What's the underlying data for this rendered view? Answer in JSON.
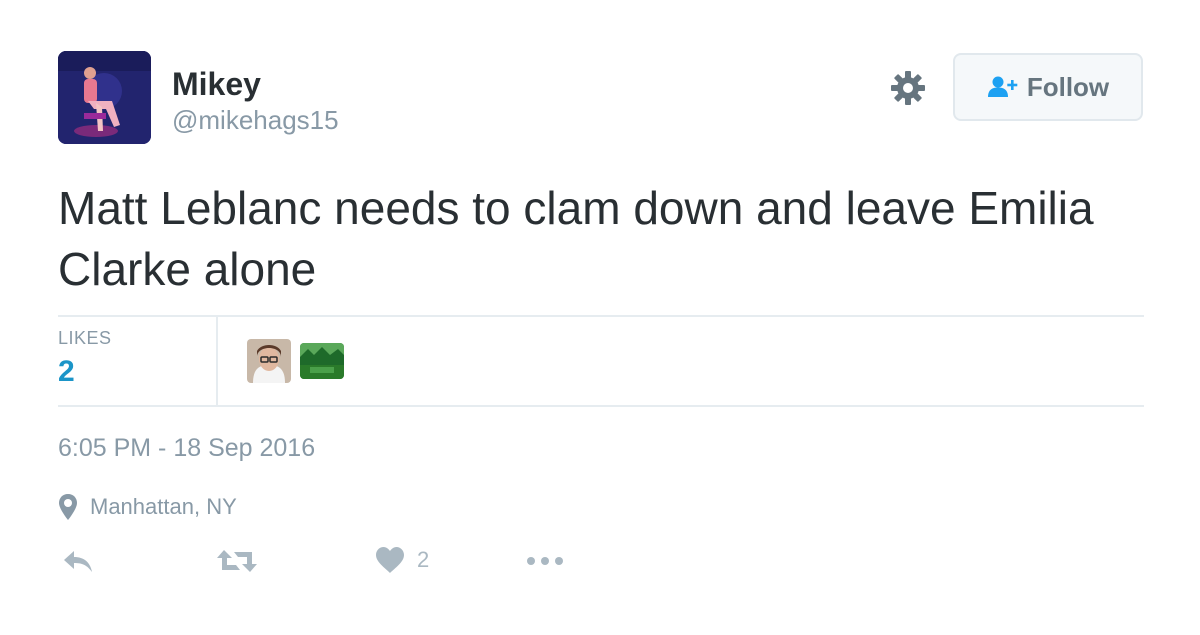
{
  "author": {
    "display_name": "Mikey",
    "handle": "@mikehags15",
    "avatar_icon": "profile-photo"
  },
  "header_actions": {
    "settings_icon": "gear-icon",
    "follow_label": "Follow",
    "follow_icon": "add-user-icon"
  },
  "tweet": {
    "text": "Matt Leblanc needs to clam down and leave Emilia Clarke alone"
  },
  "stats": {
    "likes_label": "LIKES",
    "likes_count": "2",
    "likers": [
      "liker-avatar-person",
      "liker-avatar-landscape"
    ]
  },
  "meta": {
    "timestamp": "6:05 PM - 18 Sep 2016",
    "location": "Manhattan, NY",
    "location_icon": "map-pin-icon"
  },
  "actions": {
    "reply_icon": "reply-icon",
    "retweet_icon": "retweet-icon",
    "like_icon": "heart-icon",
    "like_count": "2",
    "more_icon": "more-dots-icon"
  },
  "colors": {
    "accent": "#1b95c8",
    "muted": "#8899a6",
    "icon": "#aab8c2",
    "text": "#292f33"
  }
}
